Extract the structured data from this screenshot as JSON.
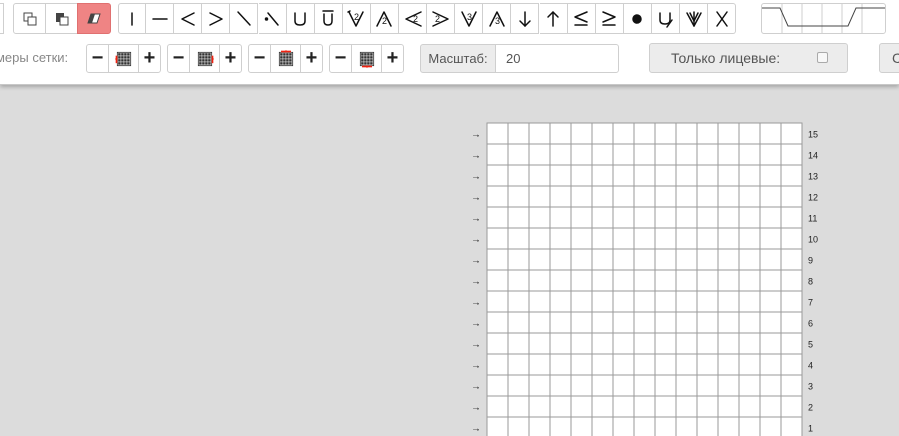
{
  "toolbar": {
    "grid_size_label": "змеры сетки:",
    "scale_label": "Масштаб:",
    "scale_value": "20",
    "only_face_label": "Только лицевые:",
    "only_face_checked": false,
    "cut_button_label": "С",
    "edit_tools": [
      {
        "name": "copy-icon"
      },
      {
        "name": "paste-icon"
      },
      {
        "name": "eraser-icon",
        "active": true
      }
    ],
    "stitch_symbols": [
      {
        "name": "knit-vertical-bar-icon"
      },
      {
        "name": "purl-horizontal-dash-icon"
      },
      {
        "name": "less-than-icon"
      },
      {
        "name": "greater-than-icon"
      },
      {
        "name": "backslash-icon"
      },
      {
        "name": "backslash-dot-icon"
      },
      {
        "name": "u-shape-icon"
      },
      {
        "name": "u-overline-icon"
      },
      {
        "name": "v-2-icon",
        "badge": "2"
      },
      {
        "name": "lambda-2-icon",
        "badge": "2"
      },
      {
        "name": "left-chevron-2-icon",
        "badge": "2"
      },
      {
        "name": "right-chevron-2-icon",
        "badge": "2"
      },
      {
        "name": "v-3-icon",
        "badge": "3"
      },
      {
        "name": "lambda-3-icon",
        "badge": "3"
      },
      {
        "name": "down-arrow-icon"
      },
      {
        "name": "up-arrow-icon"
      },
      {
        "name": "less-equal-icon"
      },
      {
        "name": "greater-equal-icon"
      },
      {
        "name": "filled-dot-icon"
      },
      {
        "name": "u-slash-icon"
      },
      {
        "name": "double-v-icon"
      },
      {
        "name": "x-cross-icon"
      }
    ],
    "grid_controls": [
      {
        "name": "left-column",
        "minus": "−",
        "plus": "+"
      },
      {
        "name": "right-column",
        "minus": "−",
        "plus": "+"
      },
      {
        "name": "top-row",
        "minus": "−",
        "plus": "+"
      },
      {
        "name": "bottom-row",
        "minus": "−",
        "plus": "+"
      }
    ]
  },
  "chart_data": {
    "type": "table",
    "columns": 15,
    "rows": [
      15,
      14,
      13,
      12,
      11,
      10,
      9,
      8,
      7,
      6,
      5,
      4,
      3,
      2,
      1
    ],
    "row_direction_marker": "→"
  }
}
